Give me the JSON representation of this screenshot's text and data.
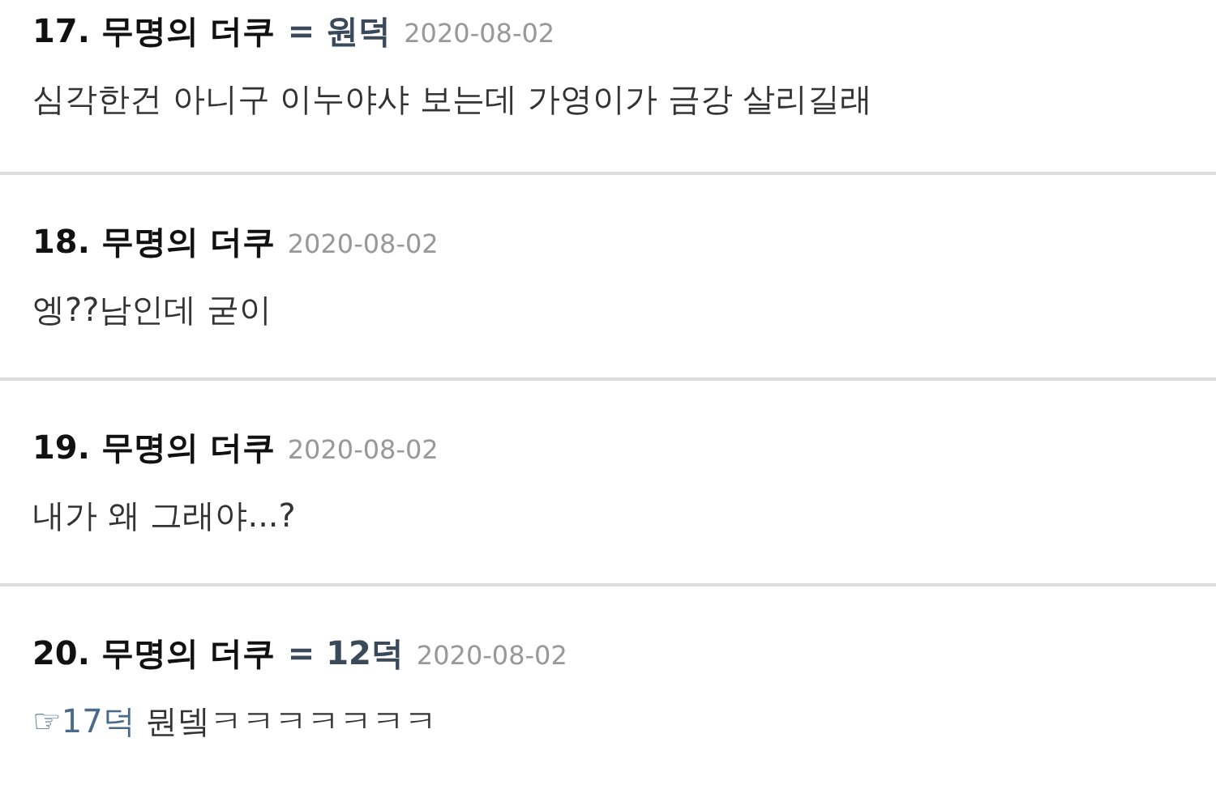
{
  "comments": [
    {
      "number": "17.",
      "author": "무명의 더쿠",
      "tag": "= 원덕",
      "date": "2020-08-02",
      "body": "심각한건 아니구 이누야샤 보는데 가영이가 금강 살리길래"
    },
    {
      "number": "18.",
      "author": "무명의 더쿠",
      "date": "2020-08-02",
      "body": "엥??남인데 굳이"
    },
    {
      "number": "19.",
      "author": "무명의 더쿠",
      "date": "2020-08-02",
      "body": "내가 왜 그래야...?"
    },
    {
      "number": "20.",
      "author": "무명의 더쿠",
      "tag": "= 12덕",
      "date": "2020-08-02",
      "reply_ref": "☞17덕",
      "body": " 뭔뎈ㅋㅋㅋㅋㅋㅋㅋ"
    }
  ]
}
